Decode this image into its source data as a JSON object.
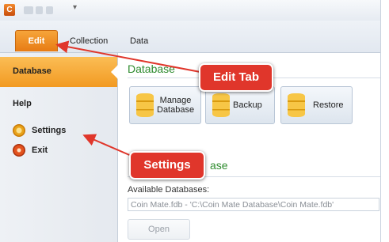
{
  "titlebar": {
    "app_icon_letter": "C",
    "quick_access_dropdown": "▾"
  },
  "ribbon": {
    "tabs": [
      {
        "label": "Edit",
        "active": true
      },
      {
        "label": "Collection",
        "active": false
      },
      {
        "label": "Data",
        "active": false
      }
    ]
  },
  "nav": {
    "database_label": "Database",
    "help_label": "Help",
    "settings_label": "Settings",
    "exit_label": "Exit"
  },
  "content": {
    "database_title": "Database",
    "manage_label": "Manage\nDatabase",
    "backup_label": "Backup",
    "restore_label": "Restore",
    "settings_title_visible": "ase",
    "available_label": "Available Databases:",
    "database_value": "Coin Mate.fdb - 'C:\\Coin Mate Database\\Coin Mate.fdb'",
    "open_label": "Open"
  },
  "callouts": {
    "edit_tab": "Edit Tab",
    "settings": "Settings"
  },
  "colors": {
    "accent_orange": "#f29a22",
    "section_green": "#2e8b2e",
    "callout_red": "#e0362b"
  }
}
